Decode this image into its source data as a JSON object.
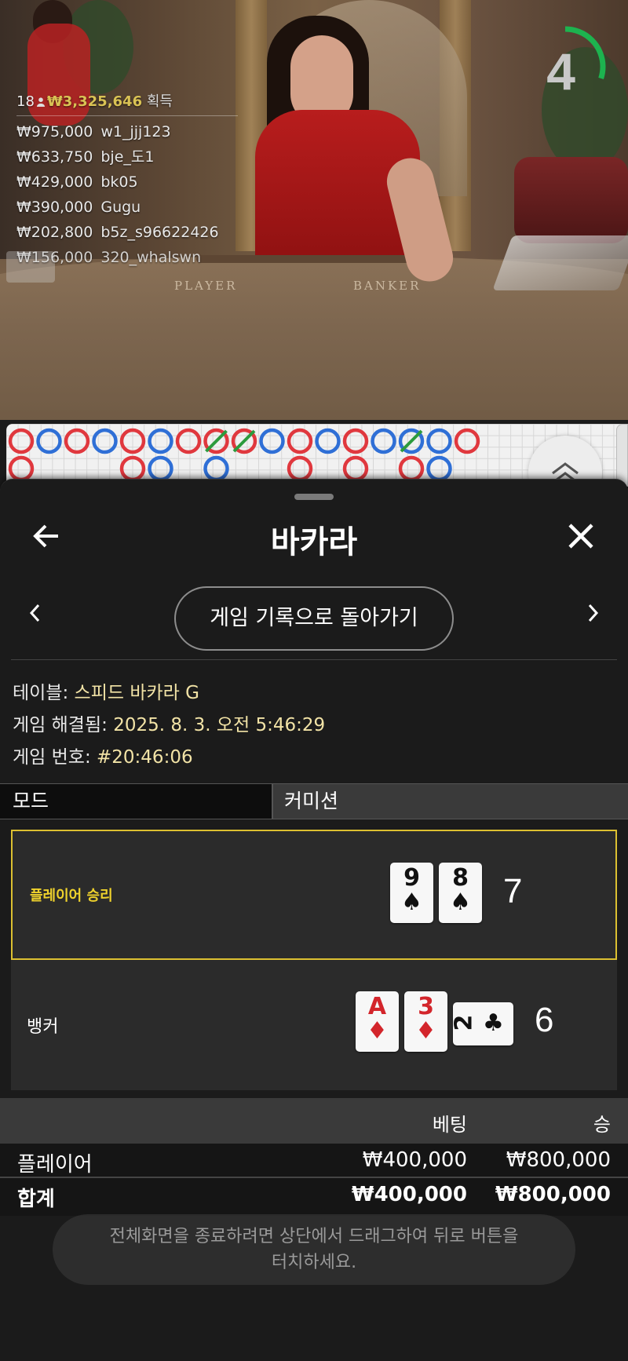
{
  "winners": {
    "count": "18",
    "total": "₩3,325,646",
    "suffix": "획득",
    "list": [
      {
        "amount": "₩975,000",
        "user": "w1_jjj123"
      },
      {
        "amount": "₩633,750",
        "user": "bje_도1"
      },
      {
        "amount": "₩429,000",
        "user": "bk05"
      },
      {
        "amount": "₩390,000",
        "user": "Gugu"
      },
      {
        "amount": "₩202,800",
        "user": "b5z_s96622426"
      },
      {
        "amount": "₩156,000",
        "user": "320_whalswn"
      }
    ]
  },
  "table_markings": {
    "player": "PLAYER",
    "banker": "BANKER"
  },
  "timer": {
    "value": "4",
    "fraction_remaining": 0.3,
    "color": "#1db34f"
  },
  "roadmap": {
    "colors": {
      "player": "#2f6fd6",
      "banker": "#e0383e",
      "tie": "#2c9b3d"
    }
  },
  "sheet": {
    "title": "바카라",
    "back_to_history": "게임 기록으로 돌아가기",
    "info": {
      "table_label": "테이블:",
      "table_value": "스피드 바카라 G",
      "resolved_label": "게임 해결됨:",
      "resolved_value": "2025. 8. 3. 오전 5:46:29",
      "number_label": "게임 번호:",
      "number_value": "#20:46:06"
    },
    "tabs": {
      "mode": "모드",
      "commission": "커미션"
    },
    "result": {
      "player_label": "플레이어 승리",
      "player_cards": [
        {
          "rank": "9",
          "suit": "♠",
          "color": "black"
        },
        {
          "rank": "8",
          "suit": "♠",
          "color": "black"
        }
      ],
      "player_score": "7",
      "banker_label": "뱅커",
      "banker_cards": [
        {
          "rank": "A",
          "suit": "♦",
          "color": "red"
        },
        {
          "rank": "3",
          "suit": "♦",
          "color": "red"
        },
        {
          "rank": "2",
          "suit": "♣",
          "color": "black"
        }
      ],
      "banker_score": "6",
      "accent": "#dcc031"
    },
    "bets": {
      "header_bet": "베팅",
      "header_win": "승",
      "rows": [
        {
          "name": "플레이어",
          "bet": "₩400,000",
          "win": "₩800,000"
        }
      ],
      "total_label": "합계",
      "total_bet": "₩400,000",
      "total_win": "₩800,000"
    },
    "toast": "전체화면을 종료하려면 상단에서 드래그하여 뒤로 버튼을\n터치하세요."
  }
}
